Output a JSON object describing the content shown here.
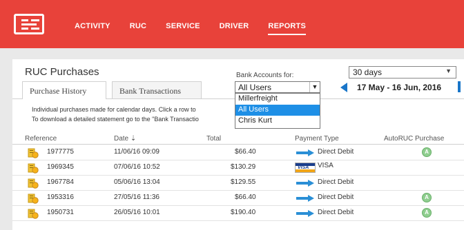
{
  "nav": {
    "items": [
      {
        "label": "ACTIVITY",
        "active": false
      },
      {
        "label": "RUC",
        "active": false
      },
      {
        "label": "SERVICE",
        "active": false
      },
      {
        "label": "DRIVER",
        "active": false
      },
      {
        "label": "REPORTS",
        "active": true
      }
    ]
  },
  "page": {
    "title": "RUC Purchases"
  },
  "tabs": [
    {
      "label": "Purchase History",
      "active": true
    },
    {
      "label": "Bank Transactions",
      "active": false
    }
  ],
  "filters": {
    "bank_accounts_label": "Bank Accounts for:",
    "bank_accounts_value": "All Users",
    "bank_accounts_options": [
      "Millerfreight",
      "All Users",
      "Chris Kurt"
    ],
    "bank_accounts_highlighted": "All Users",
    "period_value": "30 days",
    "date_range": "17 May - 16 Jun, 2016"
  },
  "info": {
    "line1": "Individual purchases made for calendar days. Click a row to",
    "line2": "To download a detailed statement go to the \"Bank Transactio"
  },
  "table": {
    "headers": {
      "reference": "Reference",
      "date": "Date ⇣",
      "total": "Total",
      "payment_type": "Payment Type",
      "auto_ruc": "AutoRUC Purchase"
    },
    "rows": [
      {
        "reference": "1977775",
        "date": "11/06/16 09:09",
        "total": "$66.40",
        "payment": "Direct Debit",
        "method": "direct-debit",
        "auto": true
      },
      {
        "reference": "1969345",
        "date": "07/06/16 10:52",
        "total": "$130.29",
        "payment": "VISA",
        "method": "visa",
        "auto": false
      },
      {
        "reference": "1967784",
        "date": "05/06/16 13:04",
        "total": "$129.55",
        "payment": "Direct Debit",
        "method": "direct-debit",
        "auto": false
      },
      {
        "reference": "1953316",
        "date": "27/05/16 11:36",
        "total": "$66.40",
        "payment": "Direct Debit",
        "method": "direct-debit",
        "auto": true
      },
      {
        "reference": "1950731",
        "date": "26/05/16 10:01",
        "total": "$190.40",
        "payment": "Direct Debit",
        "method": "direct-debit",
        "auto": true
      }
    ]
  },
  "icons": {
    "logo": "logo-icon",
    "receipt": "receipt-coin-icon",
    "direct_debit": "arrow-right-icon",
    "visa": "visa-card-icon",
    "auto": "auto-ruc-icon",
    "caret": "chevron-down-icon",
    "prev": "arrow-left-icon"
  },
  "colors": {
    "brand": "#e8423a",
    "accent": "#1976c9",
    "highlight": "#1e8fe6",
    "auto_green": "#8fce8f"
  }
}
